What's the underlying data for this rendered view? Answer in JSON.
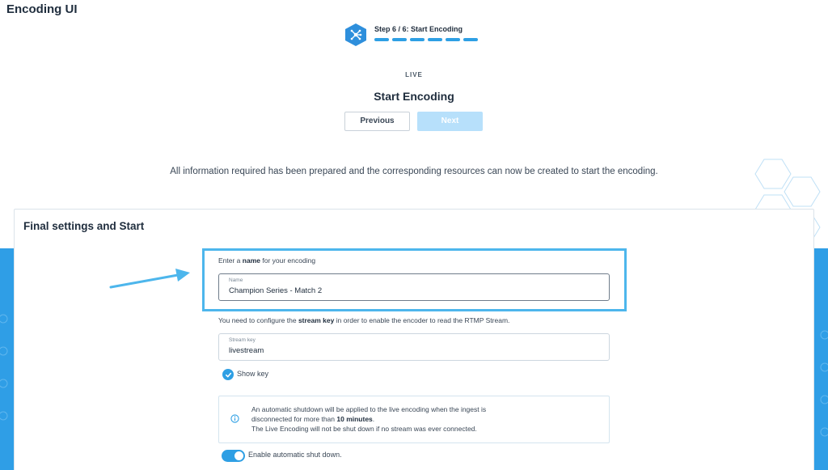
{
  "app": {
    "title": "Encoding UI"
  },
  "stepper": {
    "label": "Step 6 / 6: Start Encoding",
    "total_steps": 6,
    "completed_steps": 6
  },
  "header": {
    "mode": "LIVE",
    "title": "Start Encoding"
  },
  "nav": {
    "previous_label": "Previous",
    "next_label": "Next"
  },
  "intro": "All information required has been prepared and the corresponding resources can now be created to start the encoding.",
  "card": {
    "title": "Final settings and Start",
    "name_prompt": {
      "pre": "Enter a ",
      "bold": "name",
      "post": " for your encoding"
    },
    "name_field": {
      "label": "Name",
      "value": "Champion Series - Match 2"
    },
    "key_prompt": {
      "pre": "You need to configure the ",
      "bold": "stream key",
      "post": " in order to enable the encoder to read the RTMP Stream."
    },
    "key_field": {
      "label": "Stream key",
      "value": "livestream"
    },
    "show_key": {
      "label": "Show key",
      "checked": true
    },
    "info": {
      "line1": "An automatic shutdown will be applied to the live encoding when the ingest is",
      "line2_pre": "disconnected for more than ",
      "line2_bold": "10 minutes",
      "line2_post": ".",
      "line3": "The Live Encoding will not be shut down if no stream was ever connected."
    },
    "auto_shutdown": {
      "label": "Enable automatic shut down.",
      "enabled": true
    }
  },
  "colors": {
    "accent": "#2e9fe4",
    "highlight": "#4db6ec",
    "band": "#2f9ee6",
    "disabled_button": "#b7e0fb"
  },
  "icons": [
    "encoding-step-icon",
    "arrow-icon",
    "check-icon",
    "info-icon",
    "hexagon-decoration"
  ]
}
